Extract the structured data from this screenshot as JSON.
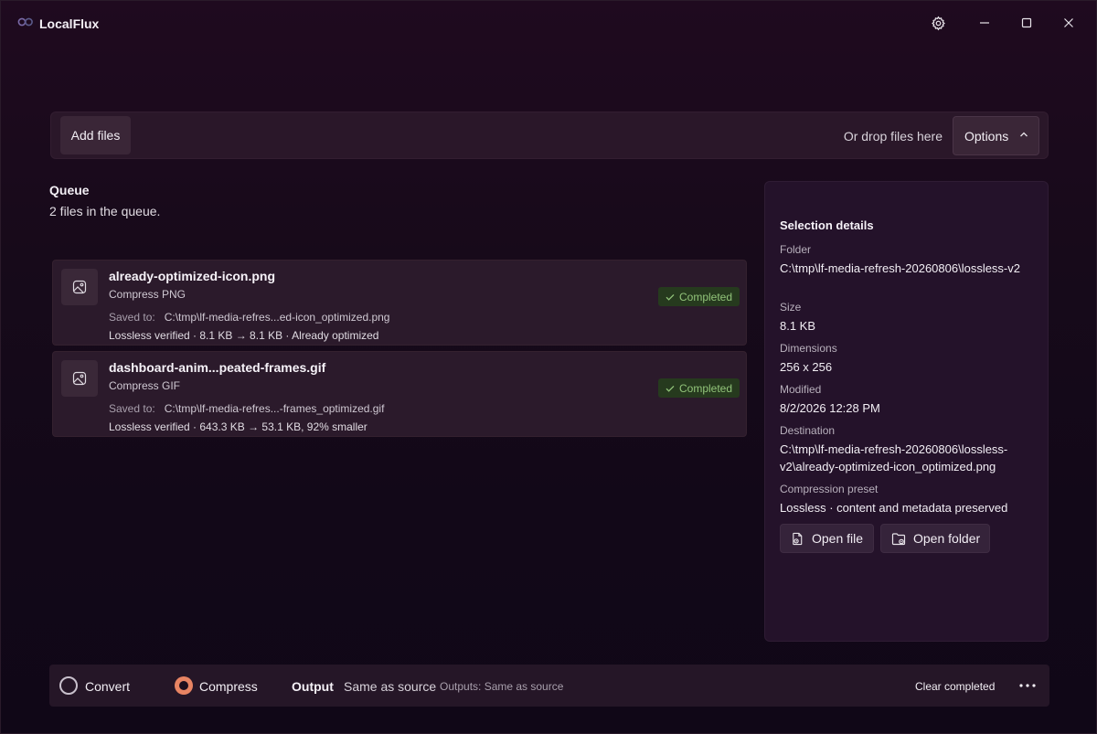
{
  "app": {
    "title": "LocalFlux"
  },
  "titlebar": {
    "settings_icon": "gear-icon",
    "minimize_icon": "minimize-icon",
    "maximize_icon": "maximize-icon",
    "close_icon": "close-icon"
  },
  "toolbar": {
    "add_files_label": "Add files",
    "drop_hint": "Or drop files here",
    "options_label": "Options"
  },
  "queue": {
    "title": "Queue",
    "count_text": "2 files in the queue.",
    "items": [
      {
        "name": "already-optimized-icon.png",
        "operation": "Compress PNG",
        "saved_label": "Saved to:",
        "saved_path": "C:\\tmp\\lf-media-refres...ed-icon_optimized.png",
        "verification": "Lossless verified · 8.1 KB → 8.1 KB · Already optimized",
        "status": "Completed"
      },
      {
        "name": "dashboard-anim...peated-frames.gif",
        "operation": "Compress GIF",
        "saved_label": "Saved to:",
        "saved_path": "C:\\tmp\\lf-media-refres...-frames_optimized.gif",
        "verification": "Lossless verified · 643.3 KB → 53.1 KB, 92% smaller",
        "status": "Completed"
      }
    ]
  },
  "details": {
    "title": "Selection details",
    "folder_label": "Folder",
    "folder_value": "C:\\tmp\\lf-media-refresh-20260806\\lossless-v2",
    "size_label": "Size",
    "size_value": "8.1 KB",
    "dimensions_label": "Dimensions",
    "dimensions_value": "256 x 256",
    "modified_label": "Modified",
    "modified_value": "8/2/2026 12:28 PM",
    "destination_label": "Destination",
    "destination_value": "C:\\tmp\\lf-media-refresh-20260806\\lossless-v2\\already-optimized-icon_optimized.png",
    "preset_label": "Compression preset",
    "preset_value": "Lossless · content and metadata preserved",
    "open_file_label": "Open file",
    "open_folder_label": "Open folder"
  },
  "bottombar": {
    "convert_label": "Convert",
    "compress_label": "Compress",
    "selected_mode": "Compress",
    "output_label": "Output",
    "output_value": "Same as source",
    "outputs_hint": "Outputs: Same as source",
    "clear_label": "Clear completed"
  },
  "colors": {
    "accent": "#e88463",
    "success_text": "#92c47a",
    "success_bg": "#263a1e"
  }
}
